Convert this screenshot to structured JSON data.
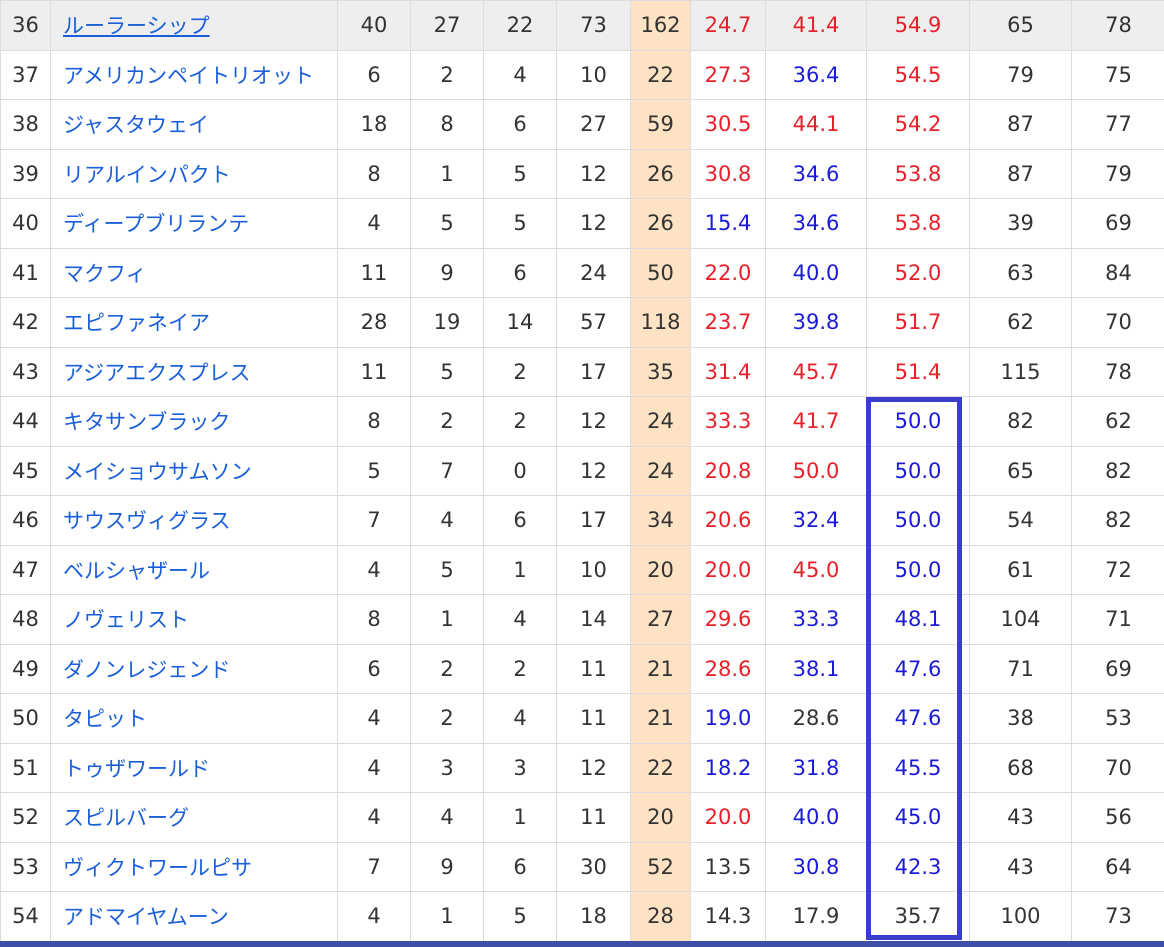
{
  "colors": {
    "name_link": "#1a5fd8",
    "red": "#e8202a",
    "blue": "#1a1ad8",
    "total_bg": "#fde2c3",
    "focus_box": "#3a3dcc"
  },
  "rows": [
    {
      "rank": "36",
      "name": "ルーラーシップ",
      "c1": "40",
      "c2": "27",
      "c3": "22",
      "c4": "73",
      "total": "162",
      "p1": "24.7",
      "p1c": "red",
      "p2": "41.4",
      "p2c": "red",
      "p3": "54.9",
      "p3c": "red",
      "n1": "65",
      "n2": "78"
    },
    {
      "rank": "37",
      "name": "アメリカンペイトリオット",
      "c1": "6",
      "c2": "2",
      "c3": "4",
      "c4": "10",
      "total": "22",
      "p1": "27.3",
      "p1c": "red",
      "p2": "36.4",
      "p2c": "blue",
      "p3": "54.5",
      "p3c": "red",
      "n1": "79",
      "n2": "75"
    },
    {
      "rank": "38",
      "name": "ジャスタウェイ",
      "c1": "18",
      "c2": "8",
      "c3": "6",
      "c4": "27",
      "total": "59",
      "p1": "30.5",
      "p1c": "red",
      "p2": "44.1",
      "p2c": "red",
      "p3": "54.2",
      "p3c": "red",
      "n1": "87",
      "n2": "77"
    },
    {
      "rank": "39",
      "name": "リアルインパクト",
      "c1": "8",
      "c2": "1",
      "c3": "5",
      "c4": "12",
      "total": "26",
      "p1": "30.8",
      "p1c": "red",
      "p2": "34.6",
      "p2c": "blue",
      "p3": "53.8",
      "p3c": "red",
      "n1": "87",
      "n2": "79"
    },
    {
      "rank": "40",
      "name": "ディープブリランテ",
      "c1": "4",
      "c2": "5",
      "c3": "5",
      "c4": "12",
      "total": "26",
      "p1": "15.4",
      "p1c": "blue",
      "p2": "34.6",
      "p2c": "blue",
      "p3": "53.8",
      "p3c": "red",
      "n1": "39",
      "n2": "69"
    },
    {
      "rank": "41",
      "name": "マクフィ",
      "c1": "11",
      "c2": "9",
      "c3": "6",
      "c4": "24",
      "total": "50",
      "p1": "22.0",
      "p1c": "red",
      "p2": "40.0",
      "p2c": "blue",
      "p3": "52.0",
      "p3c": "red",
      "n1": "63",
      "n2": "84"
    },
    {
      "rank": "42",
      "name": "エピファネイア",
      "c1": "28",
      "c2": "19",
      "c3": "14",
      "c4": "57",
      "total": "118",
      "p1": "23.7",
      "p1c": "red",
      "p2": "39.8",
      "p2c": "blue",
      "p3": "51.7",
      "p3c": "red",
      "n1": "62",
      "n2": "70"
    },
    {
      "rank": "43",
      "name": "アジアエクスプレス",
      "c1": "11",
      "c2": "5",
      "c3": "2",
      "c4": "17",
      "total": "35",
      "p1": "31.4",
      "p1c": "red",
      "p2": "45.7",
      "p2c": "red",
      "p3": "51.4",
      "p3c": "red",
      "n1": "115",
      "n2": "78"
    },
    {
      "rank": "44",
      "name": "キタサンブラック",
      "c1": "8",
      "c2": "2",
      "c3": "2",
      "c4": "12",
      "total": "24",
      "p1": "33.3",
      "p1c": "red",
      "p2": "41.7",
      "p2c": "red",
      "p3": "50.0",
      "p3c": "blue",
      "n1": "82",
      "n2": "62"
    },
    {
      "rank": "45",
      "name": "メイショウサムソン",
      "c1": "5",
      "c2": "7",
      "c3": "0",
      "c4": "12",
      "total": "24",
      "p1": "20.8",
      "p1c": "red",
      "p2": "50.0",
      "p2c": "red",
      "p3": "50.0",
      "p3c": "blue",
      "n1": "65",
      "n2": "82"
    },
    {
      "rank": "46",
      "name": "サウスヴィグラス",
      "c1": "7",
      "c2": "4",
      "c3": "6",
      "c4": "17",
      "total": "34",
      "p1": "20.6",
      "p1c": "red",
      "p2": "32.4",
      "p2c": "blue",
      "p3": "50.0",
      "p3c": "blue",
      "n1": "54",
      "n2": "82"
    },
    {
      "rank": "47",
      "name": "ベルシャザール",
      "c1": "4",
      "c2": "5",
      "c3": "1",
      "c4": "10",
      "total": "20",
      "p1": "20.0",
      "p1c": "red",
      "p2": "45.0",
      "p2c": "red",
      "p3": "50.0",
      "p3c": "blue",
      "n1": "61",
      "n2": "72"
    },
    {
      "rank": "48",
      "name": "ノヴェリスト",
      "c1": "8",
      "c2": "1",
      "c3": "4",
      "c4": "14",
      "total": "27",
      "p1": "29.6",
      "p1c": "red",
      "p2": "33.3",
      "p2c": "blue",
      "p3": "48.1",
      "p3c": "blue",
      "n1": "104",
      "n2": "71"
    },
    {
      "rank": "49",
      "name": "ダノンレジェンド",
      "c1": "6",
      "c2": "2",
      "c3": "2",
      "c4": "11",
      "total": "21",
      "p1": "28.6",
      "p1c": "red",
      "p2": "38.1",
      "p2c": "blue",
      "p3": "47.6",
      "p3c": "blue",
      "n1": "71",
      "n2": "69"
    },
    {
      "rank": "50",
      "name": "タピット",
      "c1": "4",
      "c2": "2",
      "c3": "4",
      "c4": "11",
      "total": "21",
      "p1": "19.0",
      "p1c": "blue",
      "p2": "28.6",
      "p2c": "gray",
      "p3": "47.6",
      "p3c": "blue",
      "n1": "38",
      "n2": "53"
    },
    {
      "rank": "51",
      "name": "トゥザワールド",
      "c1": "4",
      "c2": "3",
      "c3": "3",
      "c4": "12",
      "total": "22",
      "p1": "18.2",
      "p1c": "blue",
      "p2": "31.8",
      "p2c": "blue",
      "p3": "45.5",
      "p3c": "blue",
      "n1": "68",
      "n2": "70"
    },
    {
      "rank": "52",
      "name": "スピルバーグ",
      "c1": "4",
      "c2": "4",
      "c3": "1",
      "c4": "11",
      "total": "20",
      "p1": "20.0",
      "p1c": "red",
      "p2": "40.0",
      "p2c": "blue",
      "p3": "45.0",
      "p3c": "blue",
      "n1": "43",
      "n2": "56"
    },
    {
      "rank": "53",
      "name": "ヴィクトワールピサ",
      "c1": "7",
      "c2": "9",
      "c3": "6",
      "c4": "30",
      "total": "52",
      "p1": "13.5",
      "p1c": "gray",
      "p2": "30.8",
      "p2c": "blue",
      "p3": "42.3",
      "p3c": "blue",
      "n1": "43",
      "n2": "64"
    },
    {
      "rank": "54",
      "name": "アドマイヤムーン",
      "c1": "4",
      "c2": "1",
      "c3": "5",
      "c4": "18",
      "total": "28",
      "p1": "14.3",
      "p1c": "gray",
      "p2": "17.9",
      "p2c": "gray",
      "p3": "35.7",
      "p3c": "gray",
      "n1": "100",
      "n2": "73"
    }
  ]
}
